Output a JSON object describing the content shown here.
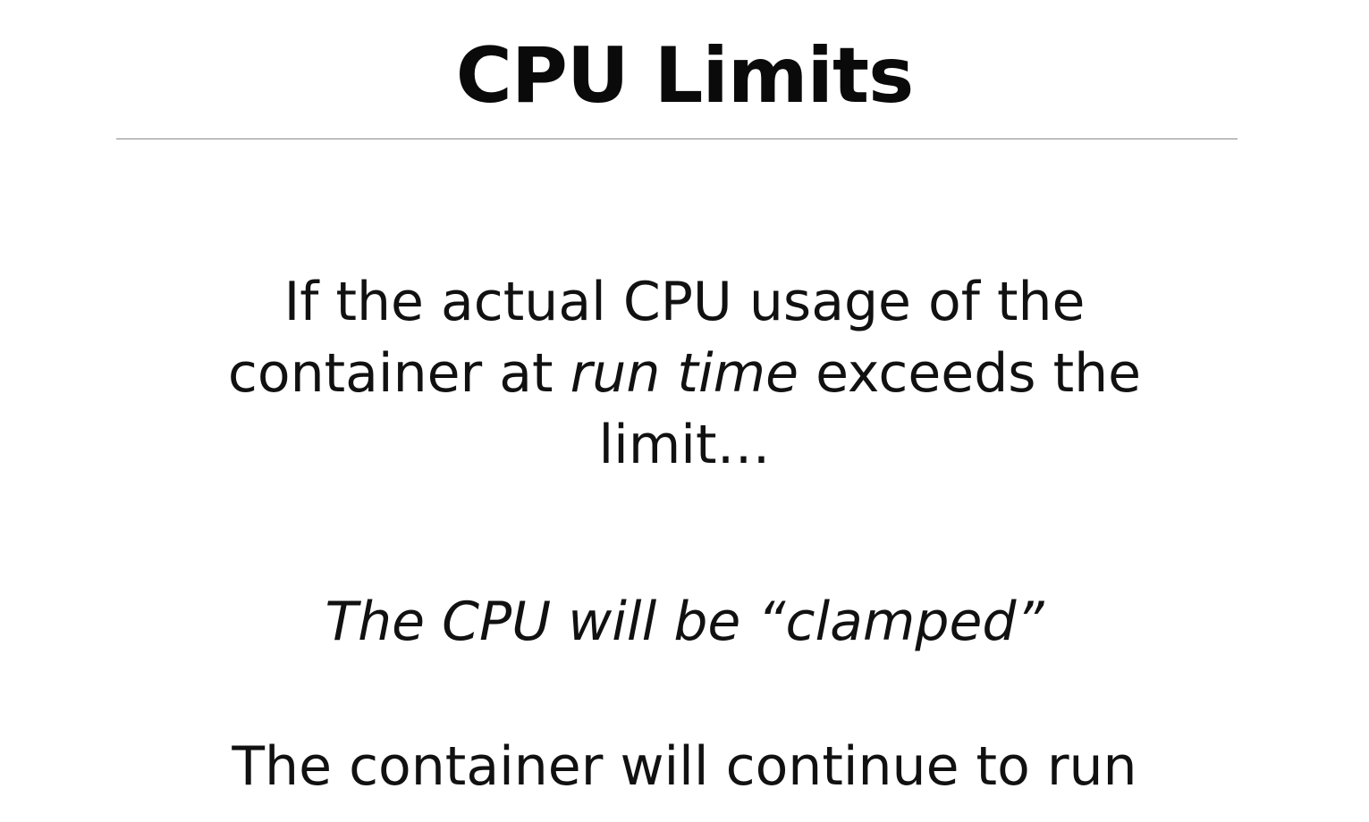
{
  "slide": {
    "title": "CPU Limits",
    "paragraph1": {
      "line1": "If the actual CPU usage of the",
      "line2_before": "container at ",
      "line2_italic": "run time",
      "line2_after": " exceeds the",
      "line3": "limit…"
    },
    "paragraph2": "The CPU will be “clamped”",
    "paragraph3": "The container will continue to run"
  }
}
